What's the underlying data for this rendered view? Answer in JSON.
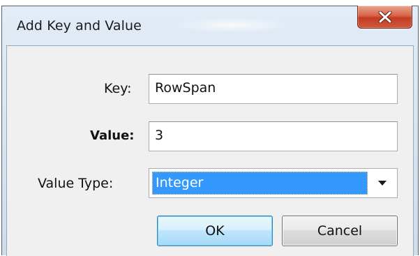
{
  "dialog": {
    "title": "Add Key and Value",
    "close_glyph": "×"
  },
  "form": {
    "key_label": "Key:",
    "key_value": "RowSpan",
    "value_label": "Value:",
    "value_value": "3",
    "value_type_label": "Value Type:",
    "value_type_selected": "Integer"
  },
  "buttons": {
    "ok_label": "OK",
    "cancel_label": "Cancel"
  },
  "icons": {
    "close": "close-icon",
    "dropdown": "chevron-down-icon"
  },
  "colors": {
    "selection": "#3399ff",
    "close_button": "#c23b21",
    "ok_button_border": "#3c7fb1"
  }
}
